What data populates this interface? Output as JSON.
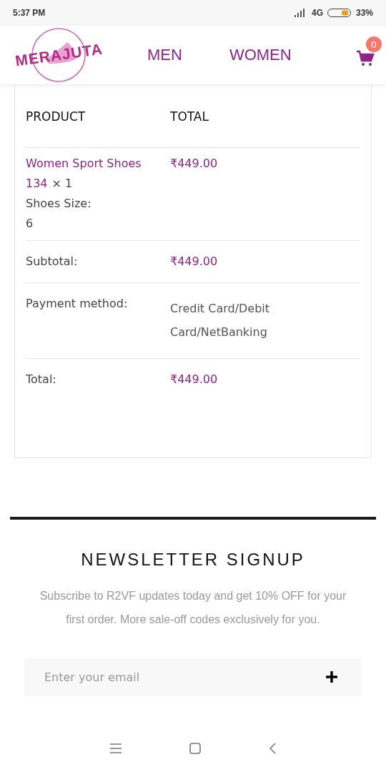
{
  "status_bar": {
    "time": "5:37 PM",
    "network": "4G",
    "battery": "33%"
  },
  "header": {
    "logo": "MERAJUTA",
    "nav": [
      {
        "label": "MEN"
      },
      {
        "label": "WOMEN"
      }
    ],
    "cart_count": "0"
  },
  "order": {
    "columns": [
      "PRODUCT",
      "TOTAL"
    ],
    "item": {
      "name": "Women Sport Shoes",
      "price": "₹449.00",
      "variant": "134",
      "quantity": "× 1",
      "meta_label": "Shoes Size:",
      "meta_value": "6"
    },
    "rows": [
      {
        "label": "Subtotal:",
        "value": "₹449.00",
        "kind": "amount"
      },
      {
        "label": "Payment method:",
        "value": "Credit Card/Debit Card/NetBanking",
        "kind": "text"
      },
      {
        "label": "Total:",
        "value": "₹449.00",
        "kind": "amount"
      }
    ]
  },
  "newsletter": {
    "title": "NEWSLETTER SIGNUP",
    "text": "Subscribe to R2VF updates today and get 10% OFF for your first order. More sale-off codes exclusively for you.",
    "placeholder": "Enter your email"
  }
}
